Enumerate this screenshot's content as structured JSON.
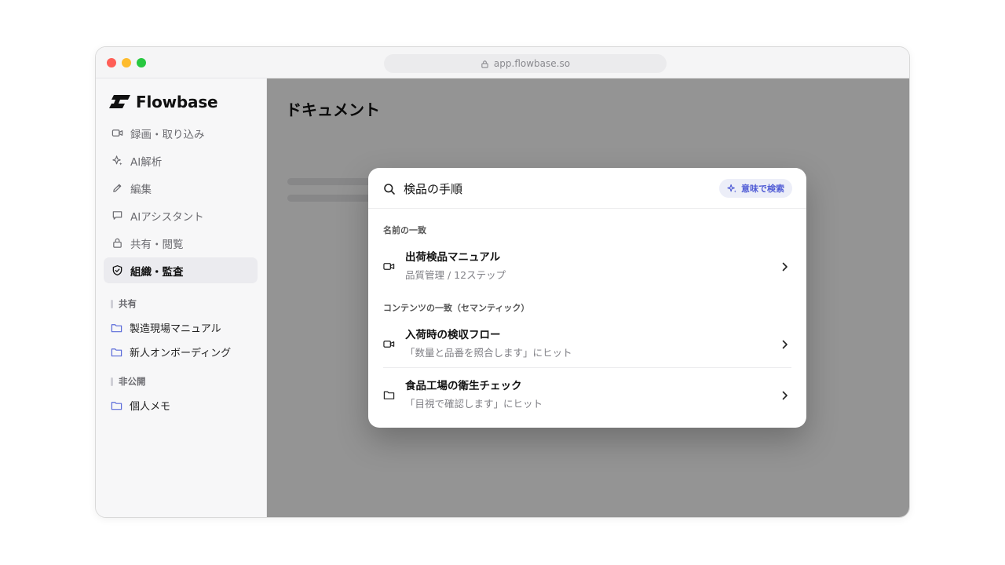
{
  "browser": {
    "url": "app.flowbase.so"
  },
  "app": {
    "name": "Flowbase"
  },
  "sidebar": {
    "nav": [
      {
        "label": "録画・取り込み",
        "icon": "video-icon"
      },
      {
        "label": "AI解析",
        "icon": "sparkle-icon"
      },
      {
        "label": "編集",
        "icon": "pencil-icon"
      },
      {
        "label": "AIアシスタント",
        "icon": "chat-icon"
      },
      {
        "label": "共有・閲覧",
        "icon": "lock-icon"
      },
      {
        "label": "組織・監査",
        "icon": "shield-icon",
        "active": true
      }
    ],
    "shared_label": "共有",
    "shared_folders": [
      "製造現場マニュアル",
      "新人オンボーディング"
    ],
    "private_label": "非公開",
    "private_folders": [
      "個人メモ"
    ]
  },
  "main": {
    "title": "ドキュメント"
  },
  "search": {
    "query": "検品の手順",
    "semantic_button": "意味で検索",
    "groups": [
      {
        "label": "名前の一致",
        "results": [
          {
            "title": "出荷検品マニュアル",
            "subtitle": "品質管理 / 12ステップ",
            "icon": "video-icon"
          }
        ]
      },
      {
        "label": "コンテンツの一致（セマンティック）",
        "results": [
          {
            "title": "入荷時の検収フロー",
            "subtitle": "「数量と品番を照合します」にヒット",
            "icon": "video-icon"
          },
          {
            "title": "食品工場の衛生チェック",
            "subtitle": "「目視で確認します」にヒット",
            "icon": "folder-icon"
          }
        ]
      }
    ]
  },
  "colors": {
    "accent": "#4f5bd5",
    "folder": "#5b6bd9"
  }
}
